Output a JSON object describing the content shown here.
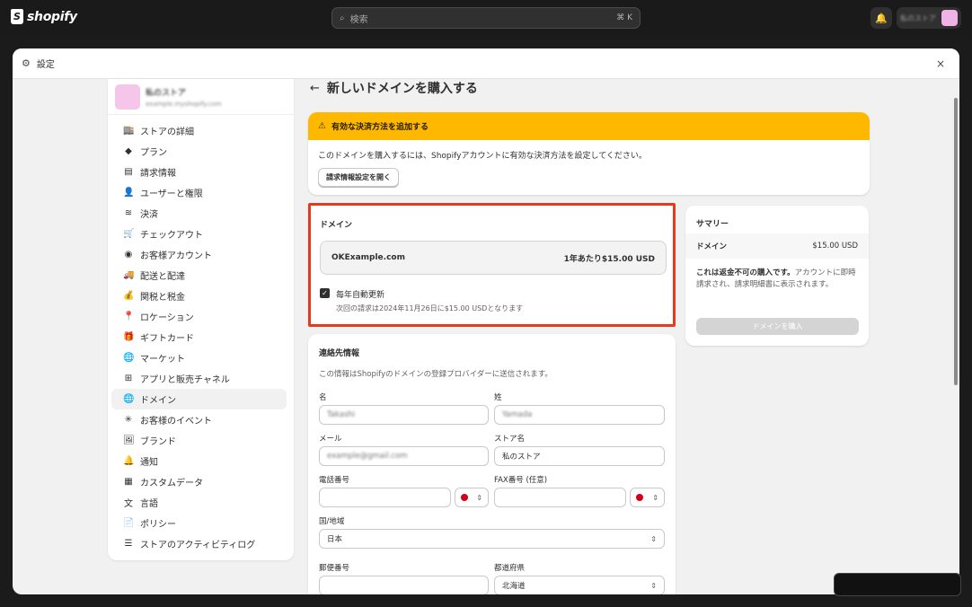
{
  "topbar": {
    "logo_text": "shopify",
    "search_placeholder": "検索",
    "search_shortcut": "⌘ K",
    "account_name": "私のストア"
  },
  "modal": {
    "title": "設定",
    "close": "×"
  },
  "sidebar": {
    "store_name": "私のストア",
    "store_url": "example.myshopify.com",
    "items": [
      {
        "label": "ストアの詳細",
        "icon": "store-icon",
        "glyph": "🏬"
      },
      {
        "label": "プラン",
        "icon": "plan-icon",
        "glyph": "◆"
      },
      {
        "label": "請求情報",
        "icon": "billing-icon",
        "glyph": "▤"
      },
      {
        "label": "ユーザーと権限",
        "icon": "users-icon",
        "glyph": "👤"
      },
      {
        "label": "決済",
        "icon": "payments-icon",
        "glyph": "≋"
      },
      {
        "label": "チェックアウト",
        "icon": "cart-icon",
        "glyph": "🛒"
      },
      {
        "label": "お客様アカウント",
        "icon": "customer-account-icon",
        "glyph": "◉"
      },
      {
        "label": "配送と配達",
        "icon": "truck-icon",
        "glyph": "🚚"
      },
      {
        "label": "関税と税金",
        "icon": "tax-icon",
        "glyph": "💰"
      },
      {
        "label": "ロケーション",
        "icon": "location-icon",
        "glyph": "📍"
      },
      {
        "label": "ギフトカード",
        "icon": "gift-card-icon",
        "glyph": "🎁"
      },
      {
        "label": "マーケット",
        "icon": "globe-icon",
        "glyph": "🌐"
      },
      {
        "label": "アプリと販売チャネル",
        "icon": "apps-icon",
        "glyph": "⊞"
      },
      {
        "label": "ドメイン",
        "icon": "domain-icon",
        "glyph": "🌐"
      },
      {
        "label": "お客様のイベント",
        "icon": "events-icon",
        "glyph": "✳"
      },
      {
        "label": "ブランド",
        "icon": "brand-icon",
        "glyph": "🖼"
      },
      {
        "label": "通知",
        "icon": "bell-icon",
        "glyph": "🔔"
      },
      {
        "label": "カスタムデータ",
        "icon": "custom-data-icon",
        "glyph": "▦"
      },
      {
        "label": "言語",
        "icon": "language-icon",
        "glyph": "文"
      },
      {
        "label": "ポリシー",
        "icon": "policy-icon",
        "glyph": "📄"
      },
      {
        "label": "ストアのアクティビティログ",
        "icon": "list-icon",
        "glyph": "☰"
      }
    ],
    "active_index": 13
  },
  "main": {
    "title": "新しいドメインを購入する",
    "banner": {
      "title": "有効な決済方法を追加する",
      "text": "このドメインを購入するには、Shopifyアカウントに有効な決済方法を設定してください。",
      "button": "請求情報設定を開く",
      "color": "#ffb800"
    },
    "domain": {
      "title": "ドメイン",
      "name": "OKExample.com",
      "price": "1年あたり$15.00 USD",
      "auto_renew_label": "毎年自動更新",
      "auto_renew_checked": true,
      "next_billing": "次回の請求は2024年11月26日に$15.00 USDとなります",
      "highlight_color": "#e63a1e"
    },
    "contact": {
      "title": "連絡先情報",
      "description": "この情報はShopifyのドメインの登録プロバイダーに送信されます。",
      "first_name_label": "名",
      "first_name_value": "Takashi",
      "last_name_label": "姓",
      "last_name_value": "Yamada",
      "email_label": "メール",
      "email_value": "example@gmail.com",
      "store_name_label": "ストア名",
      "store_name_value": "私のストア",
      "phone_label": "電話番号",
      "fax_label": "FAX番号 (任意)",
      "country_label": "国/地域",
      "country_value": "日本",
      "postal_label": "郵便番号",
      "prefecture_label": "都道府県",
      "prefecture_value": "北海道"
    },
    "summary": {
      "title": "サマリー",
      "row_label": "ドメイン",
      "row_value": "$15.00 USD",
      "note_bold": "これは返金不可の購入です。",
      "note_rest": "アカウントに即時請求され、請求明細書に表示されます。",
      "buy_button": "ドメインを購入"
    }
  }
}
